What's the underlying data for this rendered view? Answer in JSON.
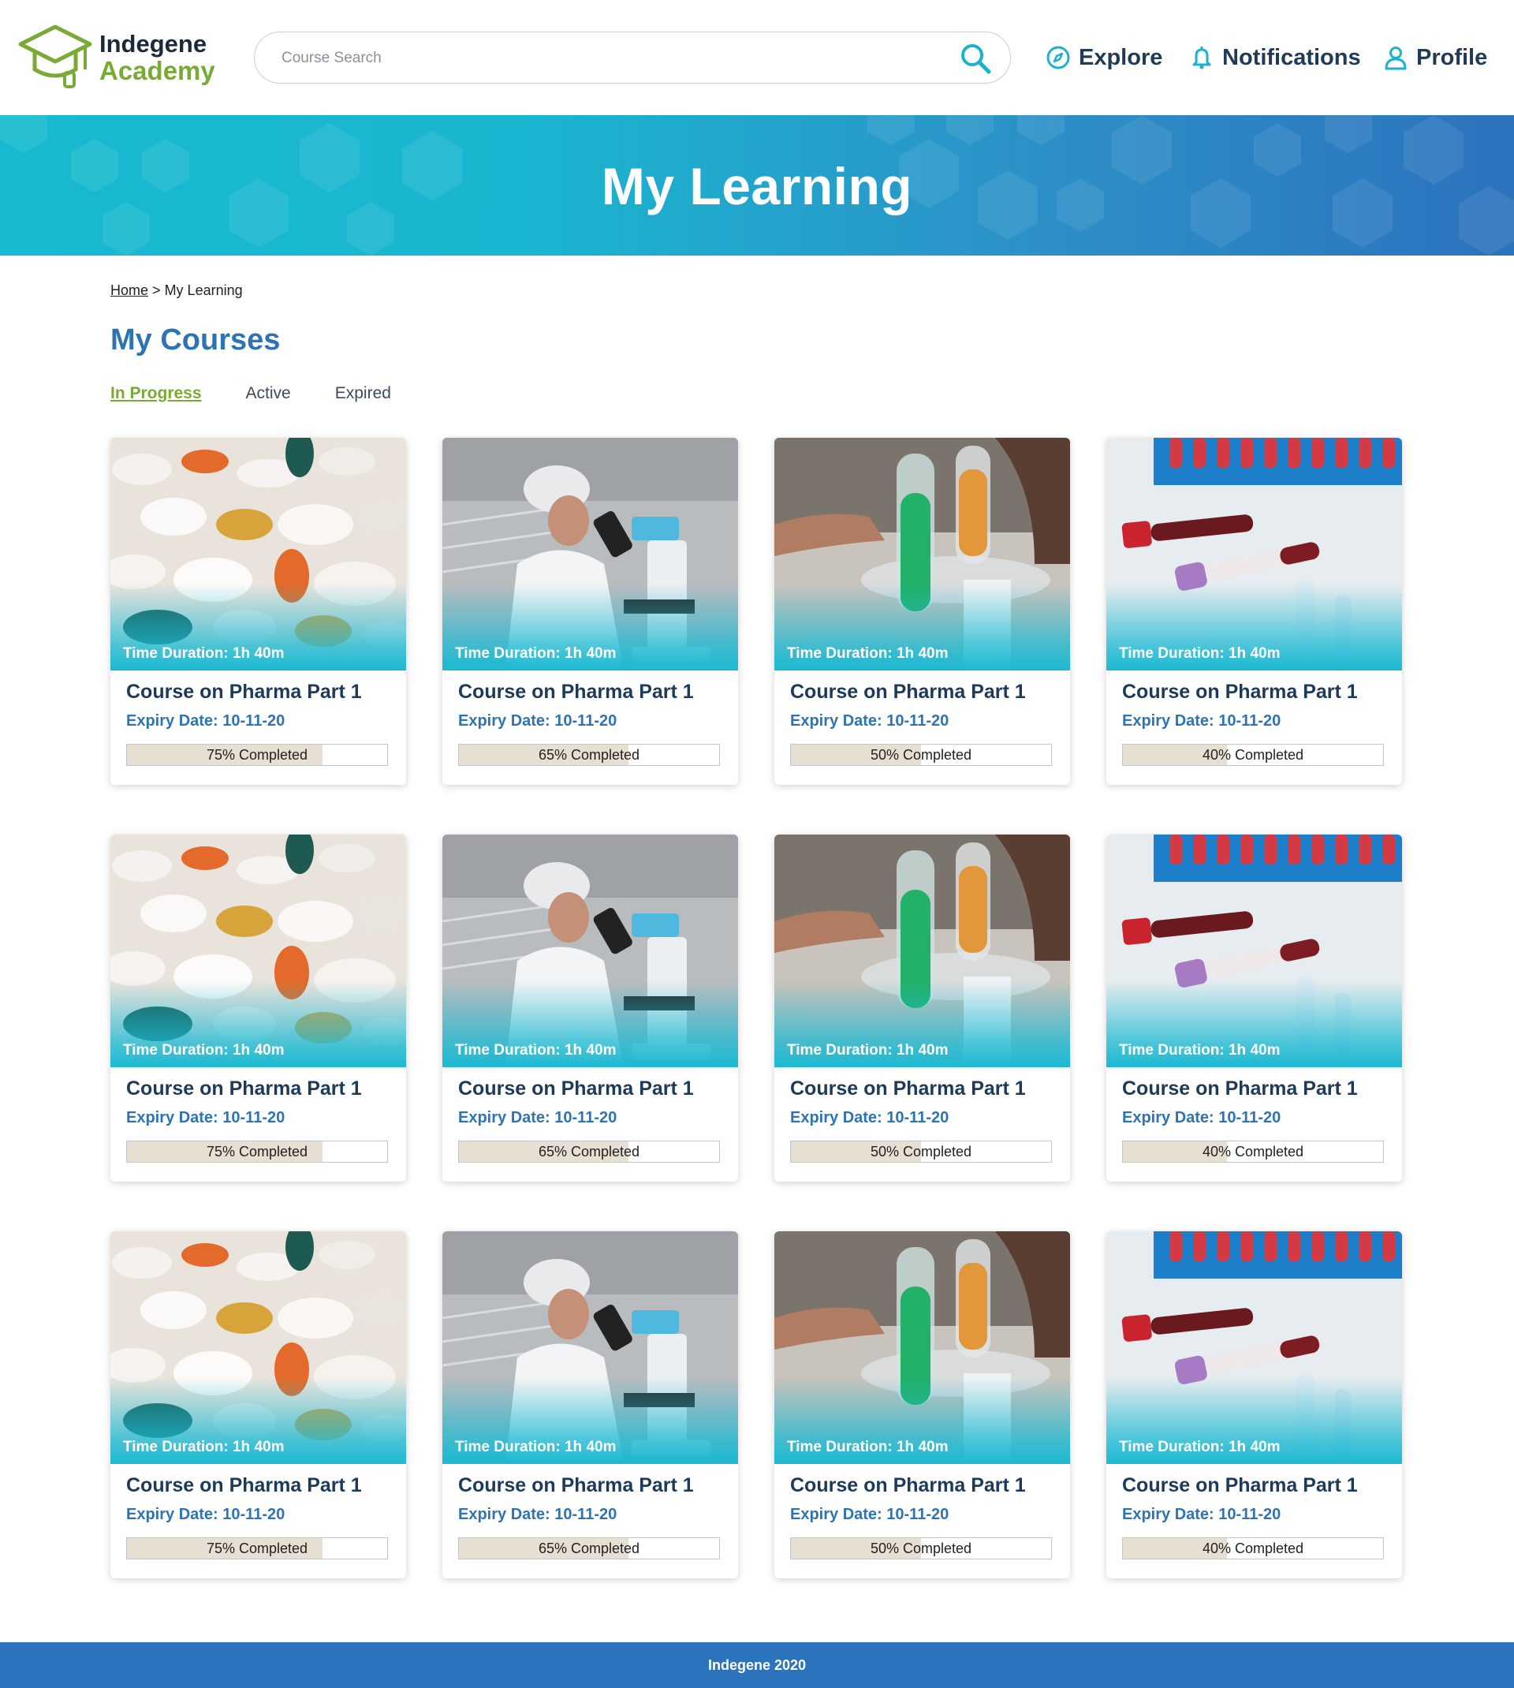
{
  "header": {
    "logo_line1": "Indegene",
    "logo_line2": "Academy",
    "search_placeholder": "Course Search",
    "nav": [
      {
        "label": "Explore",
        "icon": "compass-icon"
      },
      {
        "label": "Notifications",
        "icon": "bell-icon"
      },
      {
        "label": "Profile",
        "icon": "user-icon"
      }
    ]
  },
  "banner": {
    "title": "My Learning"
  },
  "breadcrumb": {
    "home": "Home",
    "separator": ">",
    "current": "My Learning"
  },
  "section": {
    "title": "My Courses",
    "tabs": [
      {
        "label": "In Progress",
        "active": true
      },
      {
        "label": "Active",
        "active": false
      },
      {
        "label": "Expired",
        "active": false
      }
    ]
  },
  "courses": [
    {
      "image": "pills",
      "duration": "Time Duration: 1h 40m",
      "title": "Course on Pharma Part 1",
      "expiry": "Expiry Date: 10-11-20",
      "progress": 75,
      "progress_label": "75% Completed"
    },
    {
      "image": "microscope",
      "duration": "Time Duration: 1h 40m",
      "title": "Course on Pharma Part 1",
      "expiry": "Expiry Date: 10-11-20",
      "progress": 65,
      "progress_label": "65% Completed"
    },
    {
      "image": "test-tubes",
      "duration": "Time Duration: 1h 40m",
      "title": "Course on Pharma Part 1",
      "expiry": "Expiry Date: 10-11-20",
      "progress": 50,
      "progress_label": "50% Completed"
    },
    {
      "image": "blood-tubes",
      "duration": "Time Duration: 1h 40m",
      "title": "Course on Pharma Part 1",
      "expiry": "Expiry Date: 10-11-20",
      "progress": 40,
      "progress_label": "40% Completed"
    },
    {
      "image": "pills",
      "duration": "Time Duration: 1h 40m",
      "title": "Course on Pharma Part 1",
      "expiry": "Expiry Date: 10-11-20",
      "progress": 75,
      "progress_label": "75% Completed"
    },
    {
      "image": "microscope",
      "duration": "Time Duration: 1h 40m",
      "title": "Course on Pharma Part 1",
      "expiry": "Expiry Date: 10-11-20",
      "progress": 65,
      "progress_label": "65% Completed"
    },
    {
      "image": "test-tubes",
      "duration": "Time Duration: 1h 40m",
      "title": "Course on Pharma Part 1",
      "expiry": "Expiry Date: 10-11-20",
      "progress": 50,
      "progress_label": "50% Completed"
    },
    {
      "image": "blood-tubes",
      "duration": "Time Duration: 1h 40m",
      "title": "Course on Pharma Part 1",
      "expiry": "Expiry Date: 10-11-20",
      "progress": 40,
      "progress_label": "40% Completed"
    },
    {
      "image": "pills",
      "duration": "Time Duration: 1h 40m",
      "title": "Course on Pharma Part 1",
      "expiry": "Expiry Date: 10-11-20",
      "progress": 75,
      "progress_label": "75% Completed"
    },
    {
      "image": "microscope",
      "duration": "Time Duration: 1h 40m",
      "title": "Course on Pharma Part 1",
      "expiry": "Expiry Date: 10-11-20",
      "progress": 65,
      "progress_label": "65% Completed"
    },
    {
      "image": "test-tubes",
      "duration": "Time Duration: 1h 40m",
      "title": "Course on Pharma Part 1",
      "expiry": "Expiry Date: 10-11-20",
      "progress": 50,
      "progress_label": "50% Completed"
    },
    {
      "image": "blood-tubes",
      "duration": "Time Duration: 1h 40m",
      "title": "Course on Pharma Part 1",
      "expiry": "Expiry Date: 10-11-20",
      "progress": 40,
      "progress_label": "40% Completed"
    }
  ],
  "footer": {
    "text": "Indegene 2020"
  },
  "colors": {
    "brand_blue": "#2e74b5",
    "brand_green": "#7aaa36",
    "banner_cyan": "#17bad0",
    "footer_blue": "#2c73bd"
  }
}
